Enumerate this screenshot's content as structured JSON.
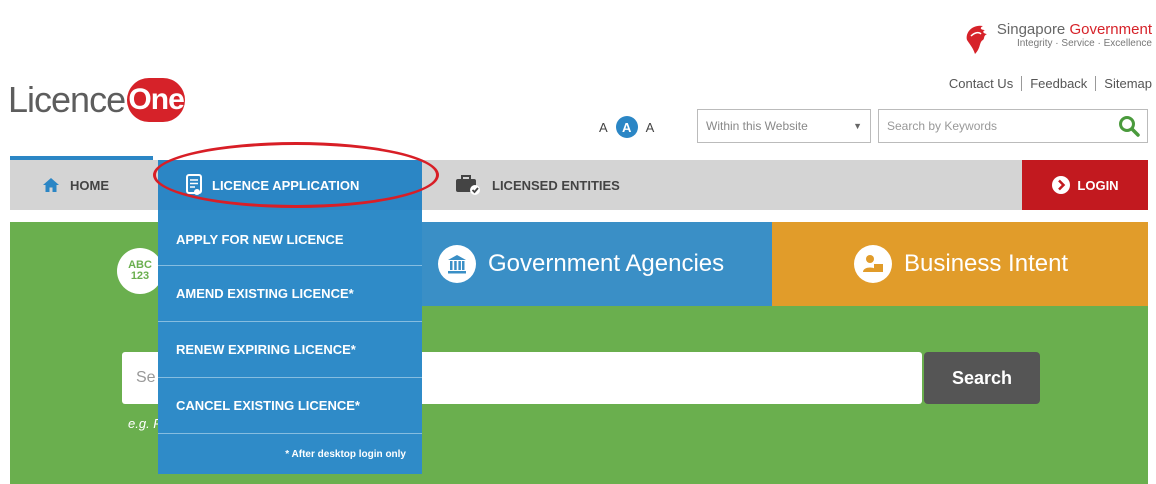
{
  "brand": {
    "logo_text": "Licence",
    "logo_badge": "One"
  },
  "gov": {
    "name_part1": "Singapore",
    "name_part2": "Government",
    "tagline": "Integrity · Service · Excellence"
  },
  "top_links": [
    "Contact Us",
    "Feedback",
    "Sitemap"
  ],
  "font_size": {
    "small": "A",
    "medium": "A",
    "large": "A"
  },
  "search_bar": {
    "scope_value": "Within this Website",
    "keyword_placeholder": "Search by Keywords"
  },
  "nav": {
    "home": "HOME",
    "licence_application": "LICENCE APPLICATION",
    "licensed_entities": "LICENSED ENTITIES",
    "login": "LOGIN"
  },
  "dropdown": {
    "items": [
      "APPLY FOR NEW LICENCE",
      "AMEND EXISTING LICENCE*",
      "RENEW EXPIRING LICENCE*",
      "CANCEL EXISTING LICENCE*"
    ],
    "note": "* After desktop login only"
  },
  "panel": {
    "abc_icon_line1": "ABC",
    "abc_icon_line2": "123",
    "tab_gov": "Government Agencies",
    "tab_biz": "Business Intent",
    "search_placeholder": "Se",
    "search_button": "Search",
    "example_text": "e.g. F"
  },
  "colors": {
    "primary_blue": "#2b86c5",
    "brand_red": "#d62229",
    "panel_green": "#6aaf4e",
    "business_orange": "#e19c2a",
    "highlight_red": "#d81e26"
  }
}
